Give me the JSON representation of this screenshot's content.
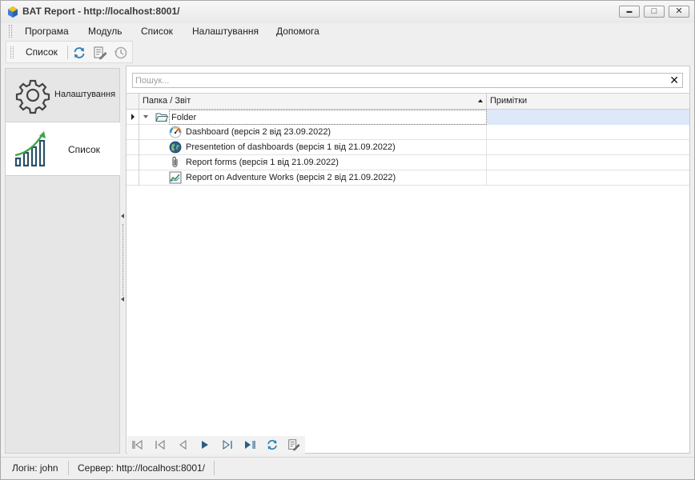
{
  "window": {
    "title": "BAT Report - http://localhost:8001/",
    "minimize_glyph": "▬",
    "maximize_glyph": "□",
    "close_glyph": "✕"
  },
  "menu": {
    "items": [
      "Програма",
      "Модуль",
      "Список",
      "Налаштування",
      "Допомога"
    ]
  },
  "toolbar": {
    "label": "Список",
    "icons": [
      "refresh-icon",
      "edit-report-icon",
      "history-icon"
    ]
  },
  "nav": {
    "items": [
      {
        "label": "Налаштування",
        "icon": "gear-icon",
        "active": false
      },
      {
        "label": "Список",
        "icon": "chart-growth-icon",
        "active": true
      }
    ]
  },
  "search": {
    "placeholder": "Пошук...",
    "value": "",
    "clear_glyph": "✕"
  },
  "grid": {
    "columns": [
      "Папка / Звіт",
      "Примітки"
    ],
    "folder": {
      "name": "Folder",
      "icon": "folder-open-icon",
      "expanded": true
    },
    "rows": [
      {
        "name": "Dashboard (версія 2 від 23.09.2022)",
        "icon": "dashboard-gauge-icon",
        "notes": ""
      },
      {
        "name": "Presentetion of dashboards (версія 1 від 21.09.2022)",
        "icon": "globe-icon",
        "notes": ""
      },
      {
        "name": "Report forms (версія 1 від 21.09.2022)",
        "icon": "paperclip-icon",
        "notes": ""
      },
      {
        "name": "Report on Adventure Works (версія 2 від 21.09.2022)",
        "icon": "line-chart-icon",
        "notes": ""
      }
    ]
  },
  "navigator": {
    "buttons": [
      "first-page-icon",
      "prev-page-icon",
      "prev-record-icon",
      "next-record-icon",
      "next-page-icon",
      "last-page-icon",
      "refresh-icon",
      "edit-icon"
    ]
  },
  "status": {
    "login": "Логін: john",
    "server": "Сервер: http://localhost:8001/"
  },
  "colors": {
    "accent_green": "#2f8a3c",
    "selection": "#dde8f8",
    "window_bg": "#efefef"
  }
}
